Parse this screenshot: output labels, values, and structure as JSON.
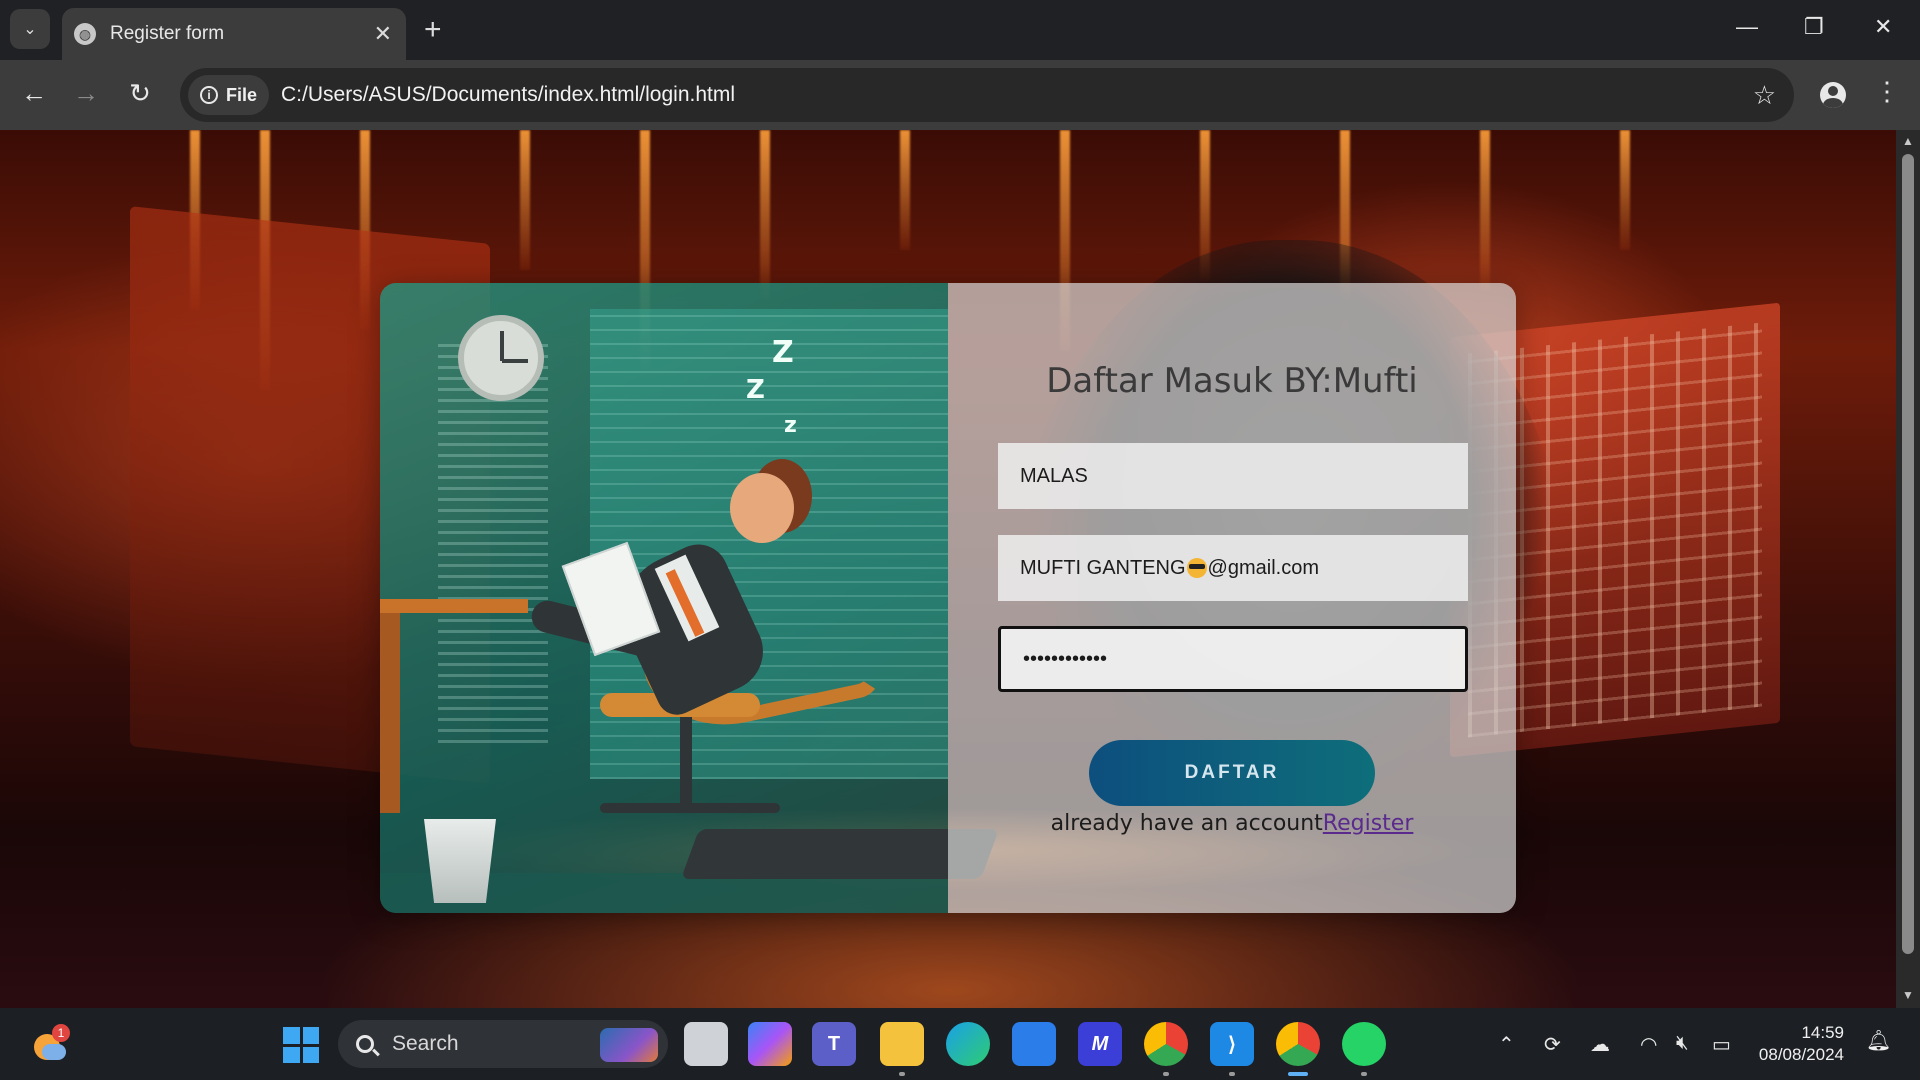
{
  "browser": {
    "tab_title": "Register form",
    "new_tab_label": "+",
    "address_chip": "File",
    "url": "C:/Users/ASUS/Documents/index.html/login.html"
  },
  "form": {
    "title": "Daftar Masuk BY:Mufti",
    "username_value": "MALAS",
    "email_value_before_emoji": "MUFTI GANTENG",
    "email_value_after_emoji": "@gmail.com",
    "password_display": "••••••••••••",
    "submit_label": "DAFTAR",
    "switch_text": "already have an account",
    "switch_link": "Register"
  },
  "taskbar": {
    "search_label": "Search",
    "weather_badge": "1",
    "time": "14:59",
    "date": "08/08/2024"
  },
  "colors": {
    "button_gradient_start": "#0d4f7e",
    "button_gradient_end": "#0e6e7a",
    "link": "#5a2b8c"
  }
}
